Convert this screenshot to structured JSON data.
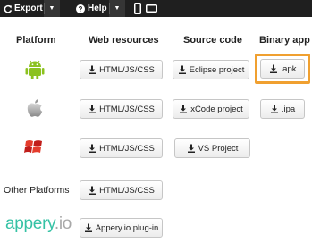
{
  "toolbar": {
    "export_label": "Export",
    "help_label": "Help"
  },
  "columns": {
    "platform": "Platform",
    "web_resources": "Web resources",
    "source_code": "Source code",
    "binary_app": "Binary app"
  },
  "rows": [
    {
      "platform": "Android",
      "web": "HTML/JS/CSS",
      "source": "Eclipse project",
      "binary": ".apk"
    },
    {
      "platform": "iOS",
      "web": "HTML/JS/CSS",
      "source": "xCode project",
      "binary": ".ipa"
    },
    {
      "platform": "Windows Phone",
      "web": "HTML/JS/CSS",
      "source": "VS Project",
      "binary": ""
    },
    {
      "platform_label": "Other Platforms",
      "web": "HTML/JS/CSS"
    },
    {
      "brand": "appery",
      "brand_suffix": ".io",
      "web": "Appery.io plug-in"
    }
  ],
  "colors": {
    "android_green": "#8cc21f",
    "highlight_orange": "#f0a030",
    "appery_teal": "#35c2a5"
  },
  "icons": {
    "export": "refresh-icon",
    "help": "question-icon",
    "device_phone": "phone-icon",
    "device_tablet": "tablet-icon",
    "download": "download-icon"
  }
}
